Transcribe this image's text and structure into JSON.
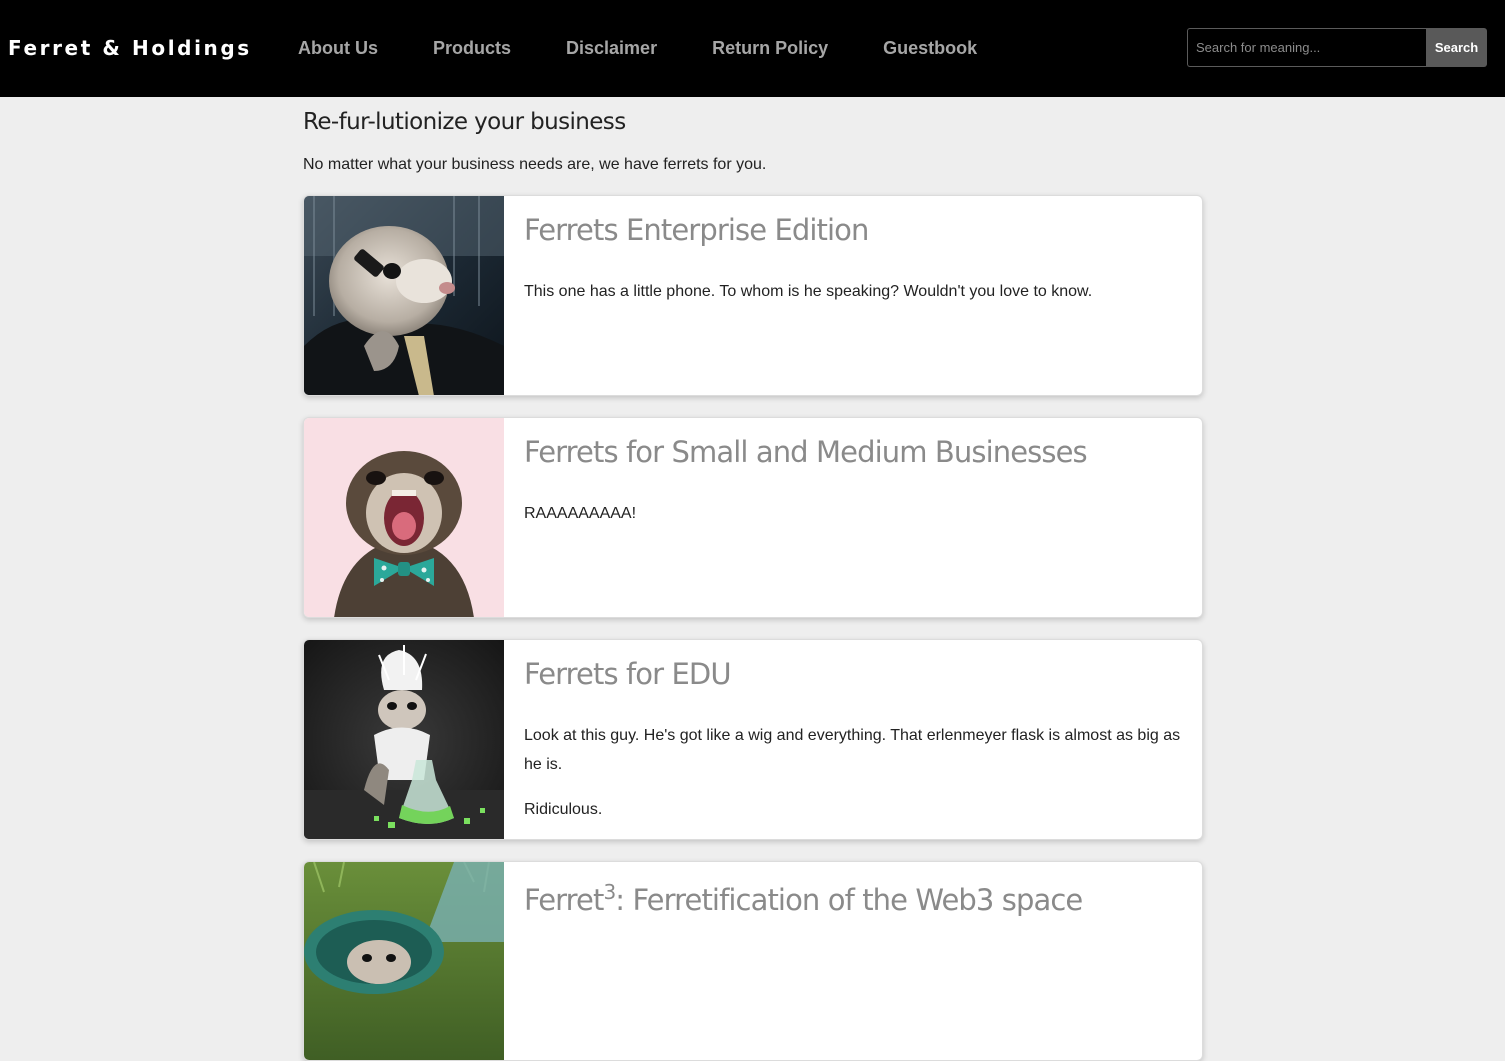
{
  "header": {
    "brand": "Ferret & Holdings",
    "nav": [
      {
        "label": "About Us"
      },
      {
        "label": "Products"
      },
      {
        "label": "Disclaimer"
      },
      {
        "label": "Return Policy"
      },
      {
        "label": "Guestbook"
      }
    ],
    "search": {
      "placeholder": "Search for meaning...",
      "value": "",
      "button_label": "Search"
    }
  },
  "main": {
    "title": "Re-fur-lutionize your business",
    "intro": "No matter what your business needs are, we have ferrets for you.",
    "products": [
      {
        "title": "Ferrets Enterprise Edition",
        "paragraphs": [
          "This one has a little phone. To whom is he speaking? Wouldn't you love to know."
        ],
        "image_icon": "ferret-with-phone-photo"
      },
      {
        "title": "Ferrets for Small and Medium Businesses",
        "paragraphs": [
          "RAAAAAAAAA!"
        ],
        "image_icon": "ferret-bowtie-photo"
      },
      {
        "title": "Ferrets for EDU",
        "paragraphs": [
          "Look at this guy. He's got like a wig and everything. That erlenmeyer flask is almost as big as he is.",
          "Ridiculous."
        ],
        "image_icon": "ferret-scientist-photo"
      },
      {
        "title_main": "Ferret",
        "title_sup": "3",
        "title_rest": ": Ferretification of the Web3 space",
        "paragraphs": [],
        "image_icon": "ferret-bucket-photo"
      }
    ]
  },
  "colors": {
    "header_bg": "#000000",
    "page_bg": "#eeeeee",
    "nav_text": "#a6a6a6",
    "card_title": "#8a8a8a",
    "search_button": "#595959"
  }
}
